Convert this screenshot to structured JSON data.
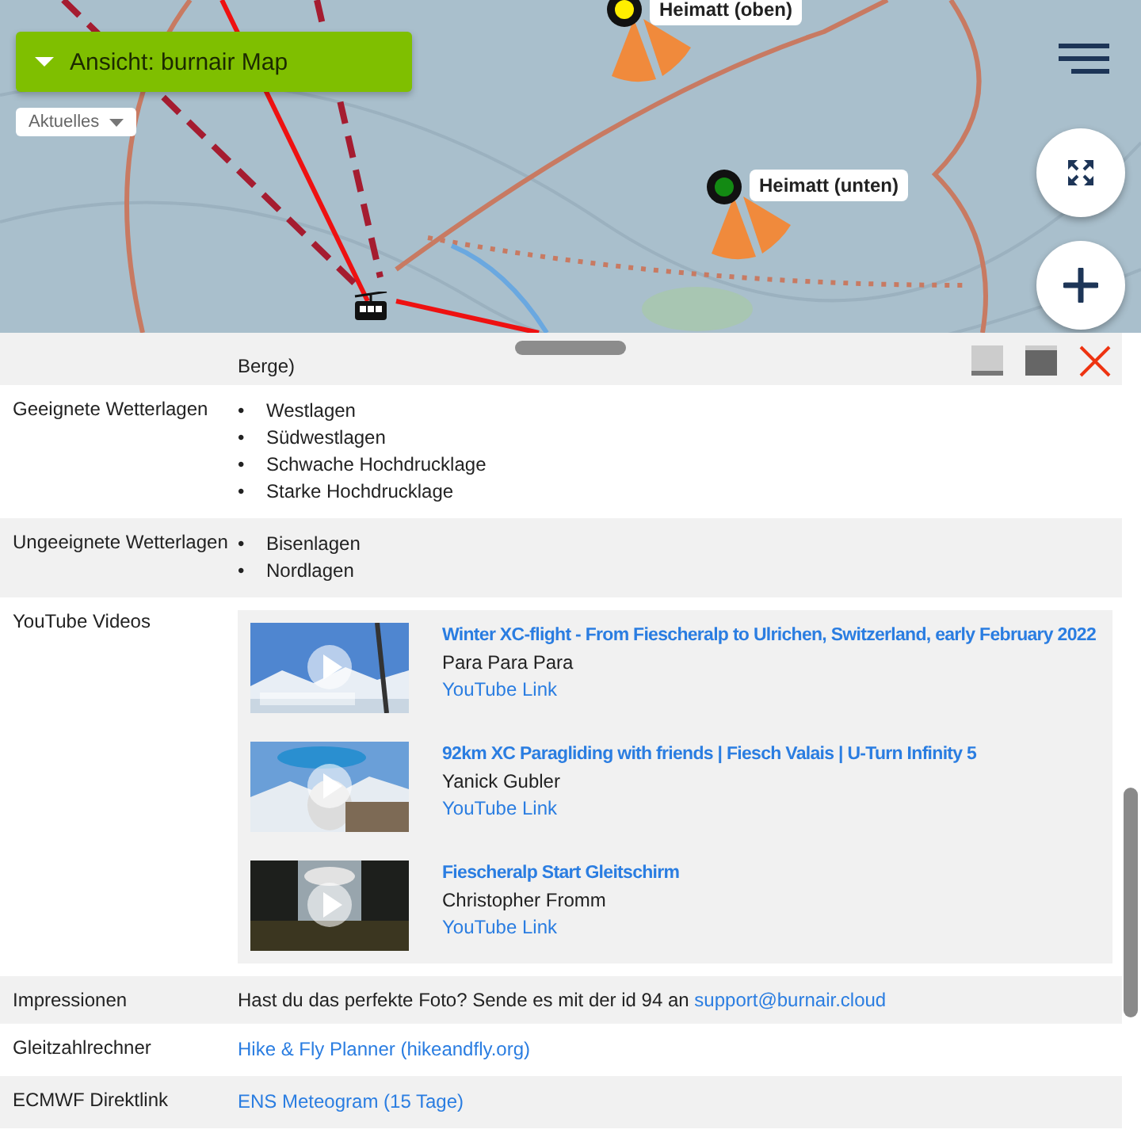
{
  "map": {
    "view_button": "Ansicht: burnair Map",
    "news_dropdown": "Aktuelles",
    "markers": [
      {
        "label": "Heimatt (oben)",
        "color": "#ffee00"
      },
      {
        "label": "Heimatt (unten)",
        "color": "#138a13"
      }
    ]
  },
  "details": {
    "note": "Berge)",
    "rows": [
      {
        "kind": "list",
        "label": "Geeignete Wetterlagen",
        "bullet": "•",
        "items": [
          "Westlagen",
          "Südwestlagen",
          "Schwache Hochdrucklage",
          "Starke Hochdrucklage"
        ]
      },
      {
        "kind": "list",
        "label": "Ungeeignete Wetterlagen",
        "bullet": "•",
        "items": [
          "Bisenlagen",
          "Nordlagen"
        ]
      },
      {
        "kind": "videos",
        "label": "YouTube Videos",
        "videos": [
          {
            "title": "Winter XC-flight - From Fiescheralp to Ulrichen, Switzerland, early February 2022",
            "channel": "Para Para Para",
            "link": "YouTube Link"
          },
          {
            "title": "92km XC Paragliding with friends | Fiesch Valais | U-Turn Infinity 5",
            "channel": "Yanick Gubler",
            "link": "YouTube Link"
          },
          {
            "title": "Fiescheralp Start Gleitschirm",
            "channel": "Christopher Fromm",
            "link": "YouTube Link"
          }
        ]
      },
      {
        "kind": "text",
        "label": "Impressionen",
        "text": "Hast du das perfekte Foto? Sende es mit der id 94 an ",
        "link": "support@burnair.cloud"
      },
      {
        "kind": "links",
        "label": "Gleitzahlrechner",
        "links": [
          "Hike & Fly Planner (hikeandfly.org)"
        ]
      },
      {
        "kind": "links",
        "label": "ECMWF Direktlink",
        "links": [
          "ENS Meteogram (15 Tage)"
        ]
      }
    ]
  }
}
